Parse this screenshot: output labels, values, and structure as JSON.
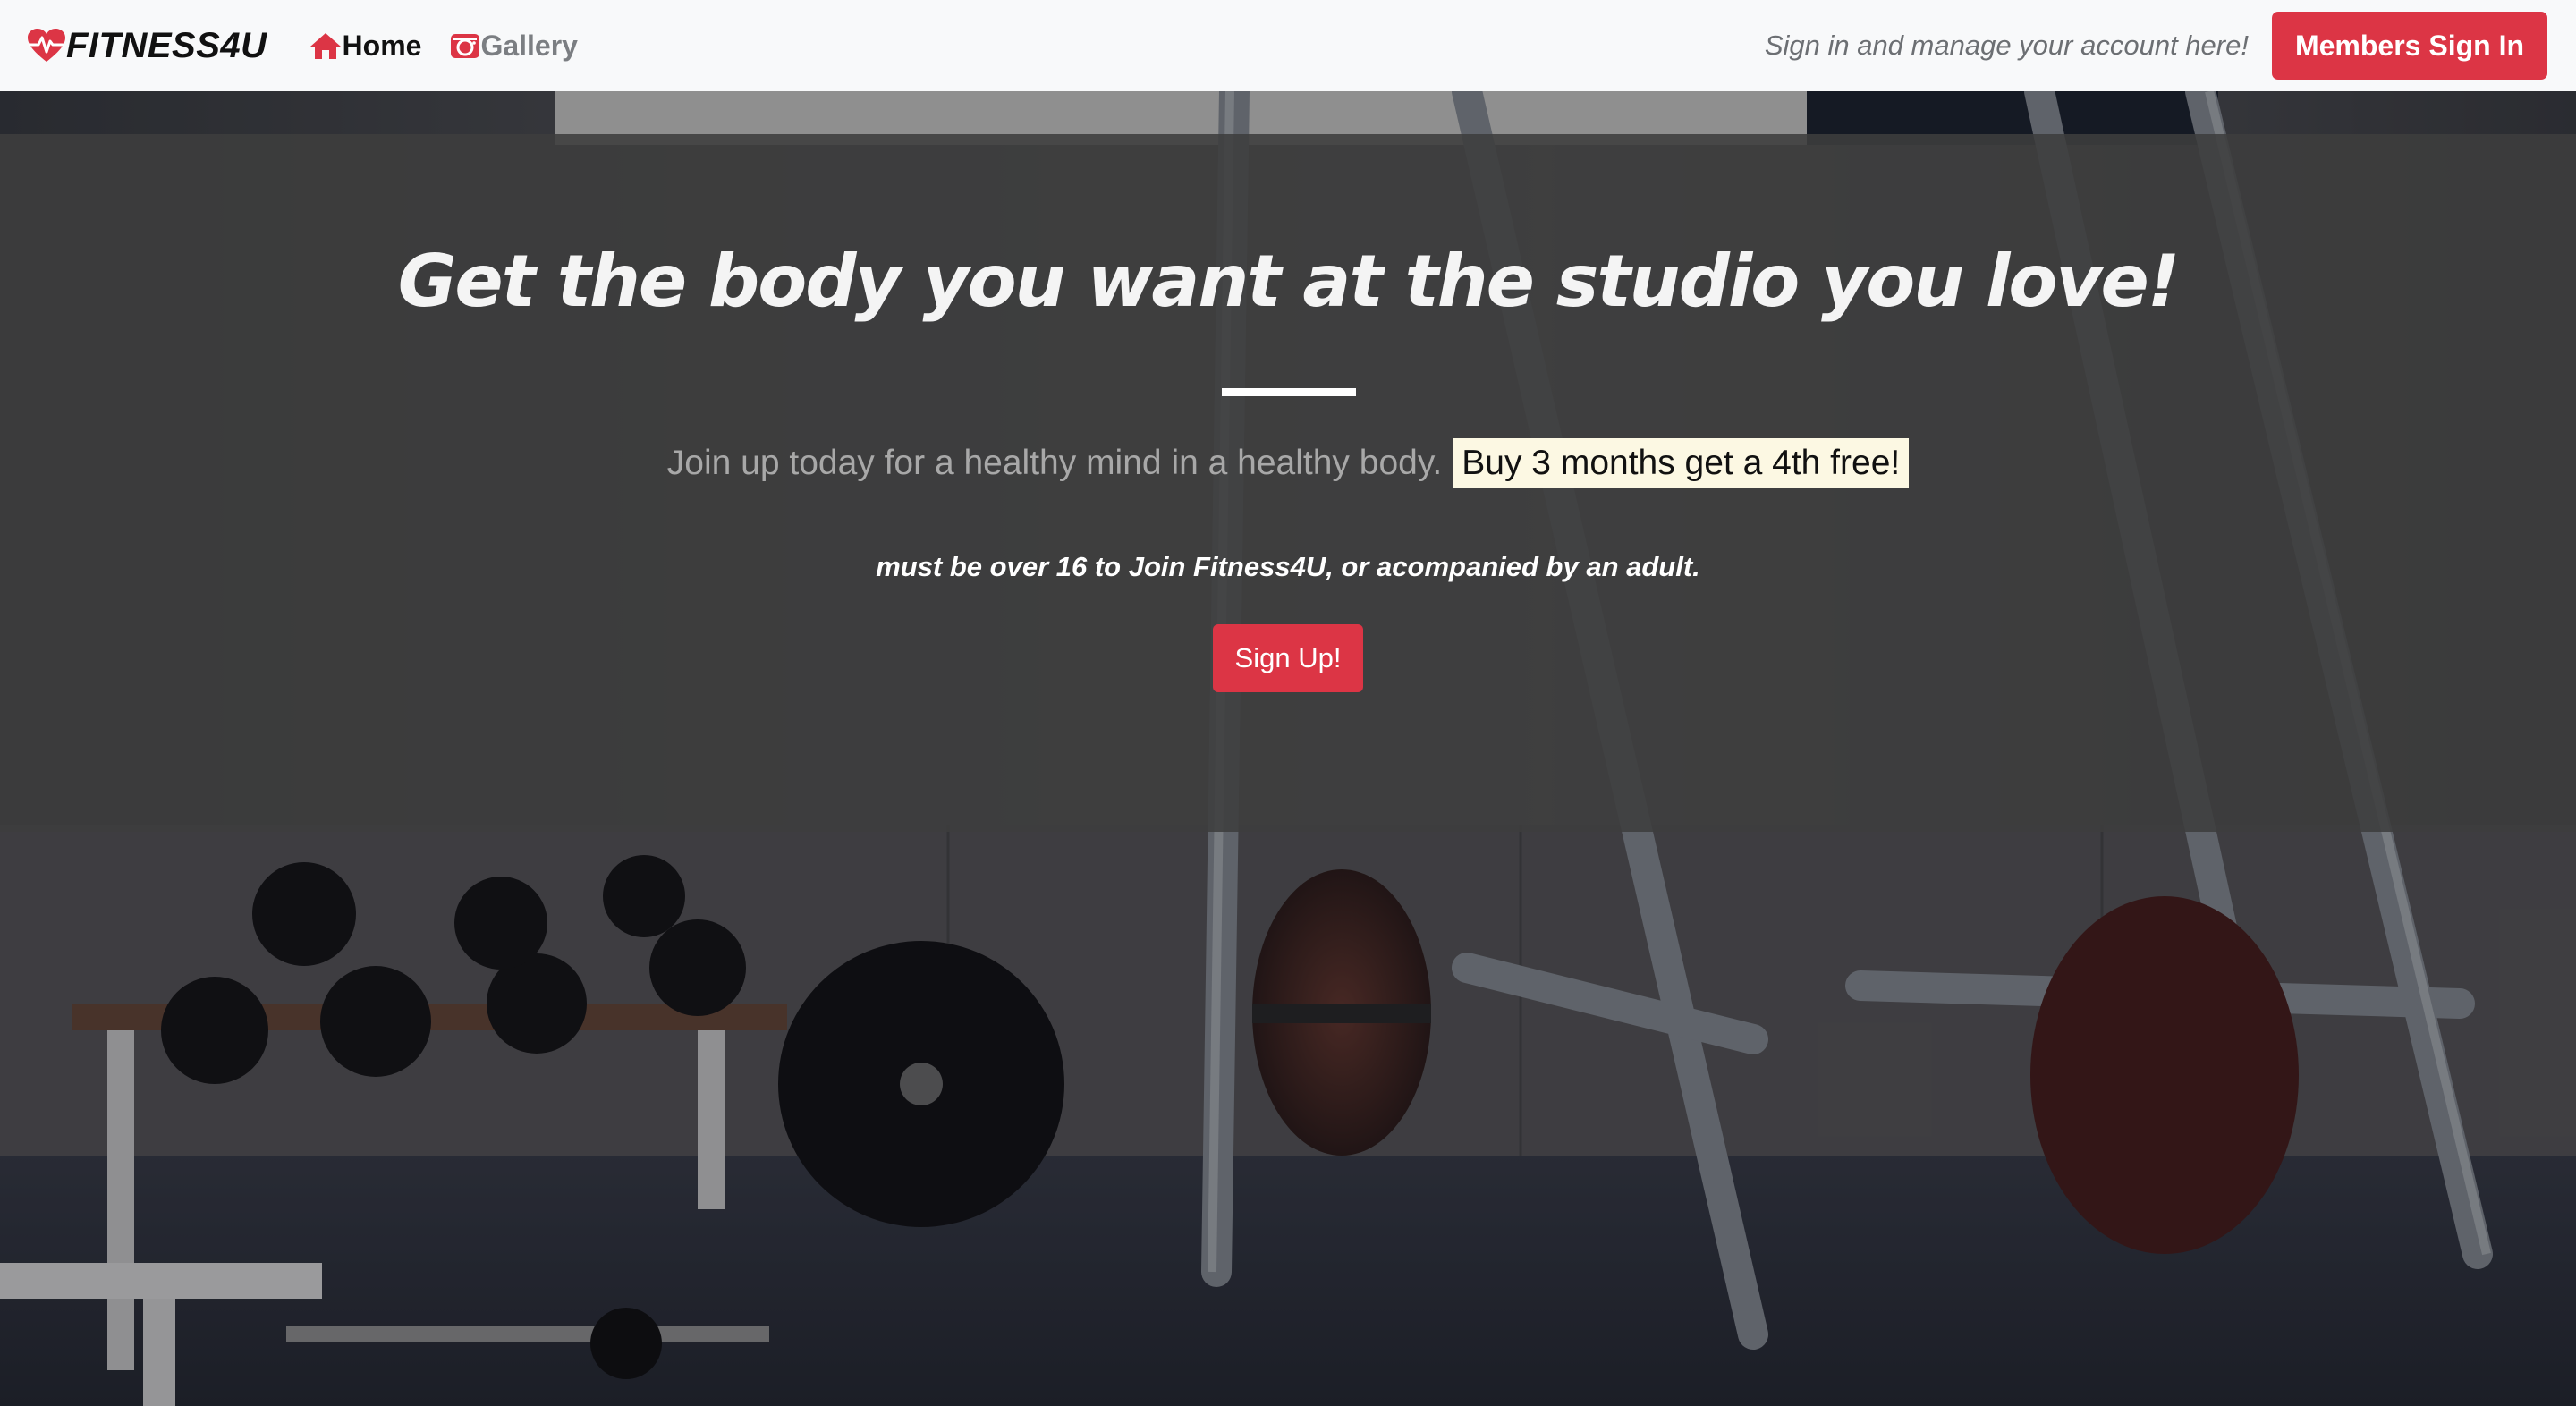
{
  "nav": {
    "brand": "FITNESS4U",
    "links": [
      {
        "label": "Home",
        "icon": "home-icon"
      },
      {
        "label": "Gallery",
        "icon": "camera-icon"
      }
    ],
    "signin_hint": "Sign in and manage your account here!",
    "members_button": "Members Sign In"
  },
  "hero": {
    "title": "Get the body you want at the studio you love!",
    "lead": "Join up today for a healthy mind in a healthy body.",
    "promo": "Buy 3 months get a 4th free!",
    "note": "must be over 16 to Join Fitness4U, or acompanied by an adult.",
    "signup_button": "Sign Up!"
  },
  "colors": {
    "accent": "#dc3545",
    "navbar_bg": "#f8f9fa",
    "hero_overlay": "#3e3e3e",
    "promo_highlight": "#fcf8e3"
  }
}
